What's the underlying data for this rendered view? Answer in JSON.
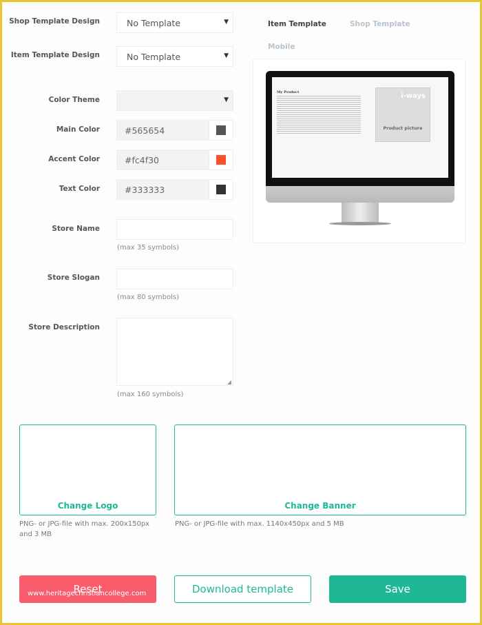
{
  "form": {
    "shop_template": {
      "label": "Shop Template Design",
      "value": "No Template"
    },
    "item_template": {
      "label": "Item Template Design",
      "value": "No Template"
    },
    "color_theme": {
      "label": "Color Theme",
      "value": ""
    },
    "main_color": {
      "label": "Main Color",
      "value": "#565654",
      "swatch": "#565654"
    },
    "accent_color": {
      "label": "Accent Color",
      "value": "#fc4f30",
      "swatch": "#fc4f30"
    },
    "text_color": {
      "label": "Text Color",
      "value": "#333333",
      "swatch": "#333333"
    },
    "store_name": {
      "label": "Store Name",
      "hint": "(max 35 symbols)"
    },
    "store_slogan": {
      "label": "Store Slogan",
      "hint": "(max 80 symbols)"
    },
    "store_description": {
      "label": "Store Description",
      "hint": "(max 160 symbols)"
    }
  },
  "preview": {
    "tabs": [
      "Item Template",
      "Shop Template",
      "Mobile"
    ],
    "active_tab": 0,
    "product_title": "My Product",
    "product_picture": "Product picture",
    "logo_text": "i-ways"
  },
  "uploads": {
    "logo": {
      "label": "Change Logo",
      "note": "PNG- or JPG-file with max. 200x150px and 3 MB"
    },
    "banner": {
      "label": "Change Banner",
      "note": "PNG- or JPG-file with max. 1140x450px and 5 MB"
    }
  },
  "buttons": {
    "reset": "Reset",
    "download": "Download template",
    "save": "Save"
  },
  "watermark": "www.heritagechristiancollege.com",
  "colors": {
    "accent": "#1fb896",
    "danger": "#f75d6c",
    "border": "#e6c52e"
  }
}
